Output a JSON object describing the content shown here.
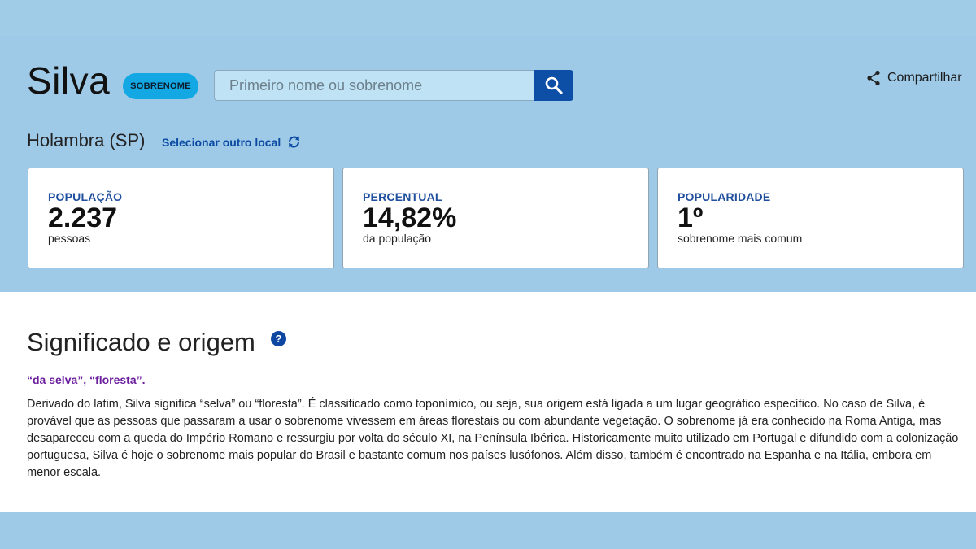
{
  "header": {
    "surname": "Silva",
    "badge": "SOBRENOME",
    "search": {
      "placeholder": "Primeiro nome ou sobrenome",
      "value": ""
    },
    "share_label": "Compartilhar"
  },
  "location": {
    "name": "Holambra (SP)",
    "change_label": "Selecionar outro local"
  },
  "stats": [
    {
      "label": "POPULAÇÃO",
      "value": "2.237",
      "sub": "pessoas"
    },
    {
      "label": "PERCENTUAL",
      "value": "14,82%",
      "sub": "da população"
    },
    {
      "label": "POPULARIDADE",
      "value": "1º",
      "sub": "sobrenome mais comum"
    }
  ],
  "origin": {
    "title": "Significado e origem",
    "help": "?",
    "meaning": "“da selva”, “floresta”.",
    "description": "Derivado do latim, Silva significa “selva” ou “floresta”. É classificado como toponímico, ou seja, sua origem está ligada a um lugar geográfico específico. No caso de Silva, é provável que as pessoas que passaram a usar o sobrenome vivessem em áreas florestais ou com abundante vegetação. O sobrenome já era conhecido na Roma Antiga, mas desapareceu com a queda do Império Romano e ressurgiu por volta do século XI, na Península Ibérica. Historicamente muito utilizado em Portugal e difundido com a colonização portuguesa, Silva é hoje o sobrenome mais popular do Brasil e bastante comum nos países lusófonos. Além disso, também é encontrado na Espanha e na Itália, embora em menor escala."
  },
  "colors": {
    "hero_bg": "#9ecae8",
    "badge_bg": "#13a8e3",
    "search_button": "#0d4ea6",
    "stat_label": "#1f4f9e",
    "meaning": "#6b1f9e"
  },
  "icons": {
    "search": "search-icon",
    "share": "share-icon",
    "refresh": "refresh-icon",
    "help": "help-icon"
  }
}
